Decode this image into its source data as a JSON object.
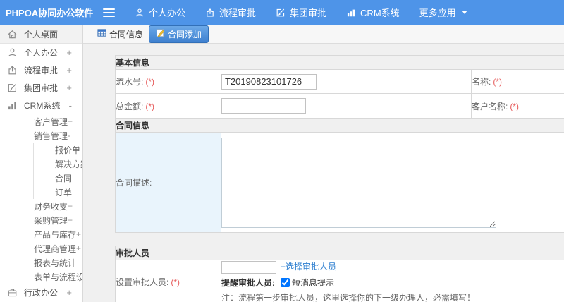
{
  "topbar": {
    "logo": "PHPOA协同办公软件",
    "nav": [
      {
        "label": "个人办公"
      },
      {
        "label": "流程审批"
      },
      {
        "label": "集团审批"
      },
      {
        "label": "CRM系统"
      },
      {
        "label": "更多应用"
      }
    ]
  },
  "sidebar": {
    "items": [
      {
        "label": "个人桌面"
      },
      {
        "label": "个人办公",
        "marker": "+"
      },
      {
        "label": "流程审批",
        "marker": "+"
      },
      {
        "label": "集团审批",
        "marker": "+"
      },
      {
        "label": "CRM系统",
        "marker": "-"
      },
      {
        "label": "客户管理",
        "marker": "+"
      },
      {
        "label": "销售管理",
        "marker": "-"
      },
      {
        "label": "报价单"
      },
      {
        "label": "解决方案"
      },
      {
        "label": "合同"
      },
      {
        "label": "订单"
      },
      {
        "label": "财务收支",
        "marker": "+"
      },
      {
        "label": "采购管理",
        "marker": "+"
      },
      {
        "label": "产品与库存",
        "marker": "+"
      },
      {
        "label": "代理商管理",
        "marker": "+"
      },
      {
        "label": "报表与统计"
      },
      {
        "label": "表单与流程设置",
        "marker": "+"
      },
      {
        "label": "行政办公",
        "marker": "+"
      }
    ]
  },
  "tabs": {
    "info": "合同信息",
    "add": "合同添加"
  },
  "form": {
    "required_mark": "(*)",
    "basic": {
      "title": "基本信息",
      "serial_label": "流水号:",
      "serial_value": "T20190823101726",
      "name_label": "名称:",
      "amount_label": "总金额:",
      "customer_label": "客户名称:"
    },
    "contract": {
      "title": "合同信息",
      "desc_label": "合同描述:"
    },
    "approver": {
      "title": "审批人员",
      "set_label": "设置审批人员:",
      "choose_link": "+选择审批人员",
      "remind_label": "提醒审批人员:",
      "sms_label": "短消息提示",
      "sms_checked": "checked",
      "note": "注：流程第一步审批人员，这里选择你的下一级办理人，必需填写！"
    }
  },
  "colors": {
    "topbar_blue": "#4e94e8",
    "active_tab_blue": "#3e80cf",
    "link_blue": "#2e7fd0",
    "required_red": "#e65c5c",
    "label_cell_blue": "#e9f4fc"
  }
}
